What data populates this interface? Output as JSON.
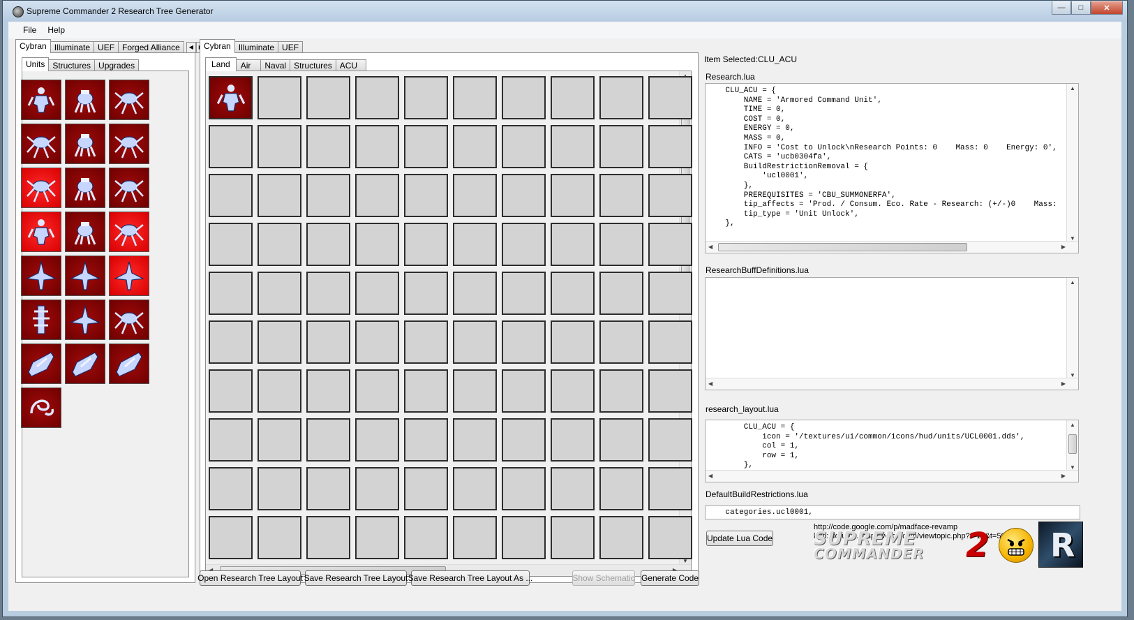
{
  "window": {
    "title": "Supreme Commander 2 Research Tree Generator",
    "minimize": "—",
    "maximize": "□",
    "close": "✕"
  },
  "menu": [
    "File",
    "Help"
  ],
  "left": {
    "faction_tabs": [
      "Cybran",
      "Illuminate",
      "UEF",
      "Forged Alliance"
    ],
    "category_tabs": [
      "Units",
      "Structures",
      "Upgrades"
    ],
    "units": [
      {
        "shade": "dark",
        "icon": "bot-icon"
      },
      {
        "shade": "dark",
        "icon": "walker-icon"
      },
      {
        "shade": "dark",
        "icon": "spider-icon"
      },
      {
        "shade": "dark",
        "icon": "spider-icon"
      },
      {
        "shade": "dark",
        "icon": "walker-icon"
      },
      {
        "shade": "dark",
        "icon": "spider-icon"
      },
      {
        "shade": "bright",
        "icon": "spider-icon"
      },
      {
        "shade": "dark",
        "icon": "walker-icon"
      },
      {
        "shade": "dark",
        "icon": "spider-icon"
      },
      {
        "shade": "bright",
        "icon": "bot-icon"
      },
      {
        "shade": "dark",
        "icon": "walker-icon"
      },
      {
        "shade": "bright",
        "icon": "spider-icon"
      },
      {
        "shade": "dark",
        "icon": "aircraft-icon"
      },
      {
        "shade": "dark",
        "icon": "aircraft-icon"
      },
      {
        "shade": "bright",
        "icon": "aircraft-icon"
      },
      {
        "shade": "dark",
        "icon": "tower-icon"
      },
      {
        "shade": "dark",
        "icon": "aircraft-icon"
      },
      {
        "shade": "dark",
        "icon": "spider-icon"
      },
      {
        "shade": "dark",
        "icon": "ship-icon"
      },
      {
        "shade": "dark",
        "icon": "ship-icon"
      },
      {
        "shade": "dark",
        "icon": "ship-icon"
      },
      {
        "shade": "dark",
        "icon": "serpent-icon"
      }
    ]
  },
  "middle": {
    "faction_tabs": [
      "Cybran",
      "Illuminate",
      "UEF"
    ],
    "category_tabs": [
      "Land",
      "Air",
      "Naval",
      "Structures",
      "ACU"
    ],
    "grid": {
      "columns": 10,
      "rows": 10,
      "filled": [
        {
          "col": 1,
          "row": 1,
          "icon": "bot-icon"
        }
      ]
    },
    "buttons": {
      "open": "Open Research Tree Layout",
      "save": "Save Research Tree Layout",
      "save_as": "Save Research Tree Layout As ...",
      "schematic": "Show Schematic",
      "generate": "Generate Code"
    }
  },
  "right": {
    "item_selected_label": "Item Selected:",
    "item_selected_value": "CLU_ACU",
    "research_label": "Research.lua",
    "research_code": "    CLU_ACU = {\n        NAME = 'Armored Command Unit',\n        TIME = 0,\n        COST = 0,\n        ENERGY = 0,\n        MASS = 0,\n        INFO = 'Cost to Unlock\\nResearch Points: 0    Mass: 0    Energy: 0',\n        CATS = 'ucb0304fa',\n        BuildRestrictionRemoval = {\n            'ucl0001',\n        },\n        PREREQUISITES = 'CBU_SUMMONERFA',\n        tip_affects = 'Prod. / Consum. Eco. Rate - Research: (+/-)0    Mass:\n        tip_type = 'Unit Unlock',\n    },",
    "buff_label": "ResearchBuffDefinitions.lua",
    "layout_label": "research_layout.lua",
    "layout_code": "        CLU_ACU = {\n            icon = '/textures/ui/common/icons/hud/units/UCL0001.dds',\n            col = 1,\n            row = 1,\n        },",
    "restrictions_label": "DefaultBuildRestrictions.lua",
    "restrictions_code": "    categories.ucl0001,",
    "update_button": "Update Lua Code",
    "links": [
      "http://code.google.com/p/madface-revamp",
      "http://forums.gaspowered.com/viewtopic.php?f=19&t=50708"
    ],
    "logo_line1": "SUPREME",
    "logo_line2": "COMMANDER",
    "logo_number": "2",
    "r_logo": "R"
  }
}
